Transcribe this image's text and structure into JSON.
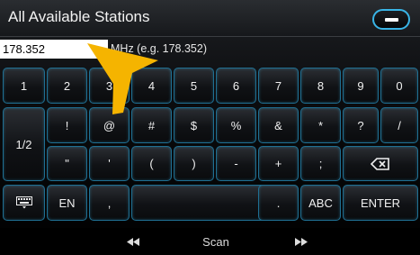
{
  "header": {
    "title": "All Available Stations",
    "close_icon": "minus-icon"
  },
  "input": {
    "value": "178.352",
    "hint": "MHz (e.g. 178.352)"
  },
  "keyboard": {
    "row1": [
      "1",
      "2",
      "3",
      "4",
      "5",
      "6",
      "7",
      "8",
      "9",
      "0"
    ],
    "row2": [
      "!",
      "@",
      "#",
      "$",
      "%",
      "&",
      "*",
      "?",
      "/"
    ],
    "row3": [
      "\"",
      "'",
      "(",
      ")",
      "-",
      "+",
      ";"
    ],
    "shift_label": "1/2",
    "backspace_icon": "backspace-icon",
    "keyboard_icon": "keyboard-icon",
    "lang_label": "EN",
    "comma_label": ",",
    "period_label": ".",
    "abc_label": "ABC",
    "enter_label": "ENTER"
  },
  "bottom": {
    "prev_icon": "rewind-icon",
    "scan_label": "Scan",
    "next_icon": "fast-forward-icon"
  },
  "colors": {
    "accent": "#39b4e6",
    "arrow": "#f5b400"
  }
}
